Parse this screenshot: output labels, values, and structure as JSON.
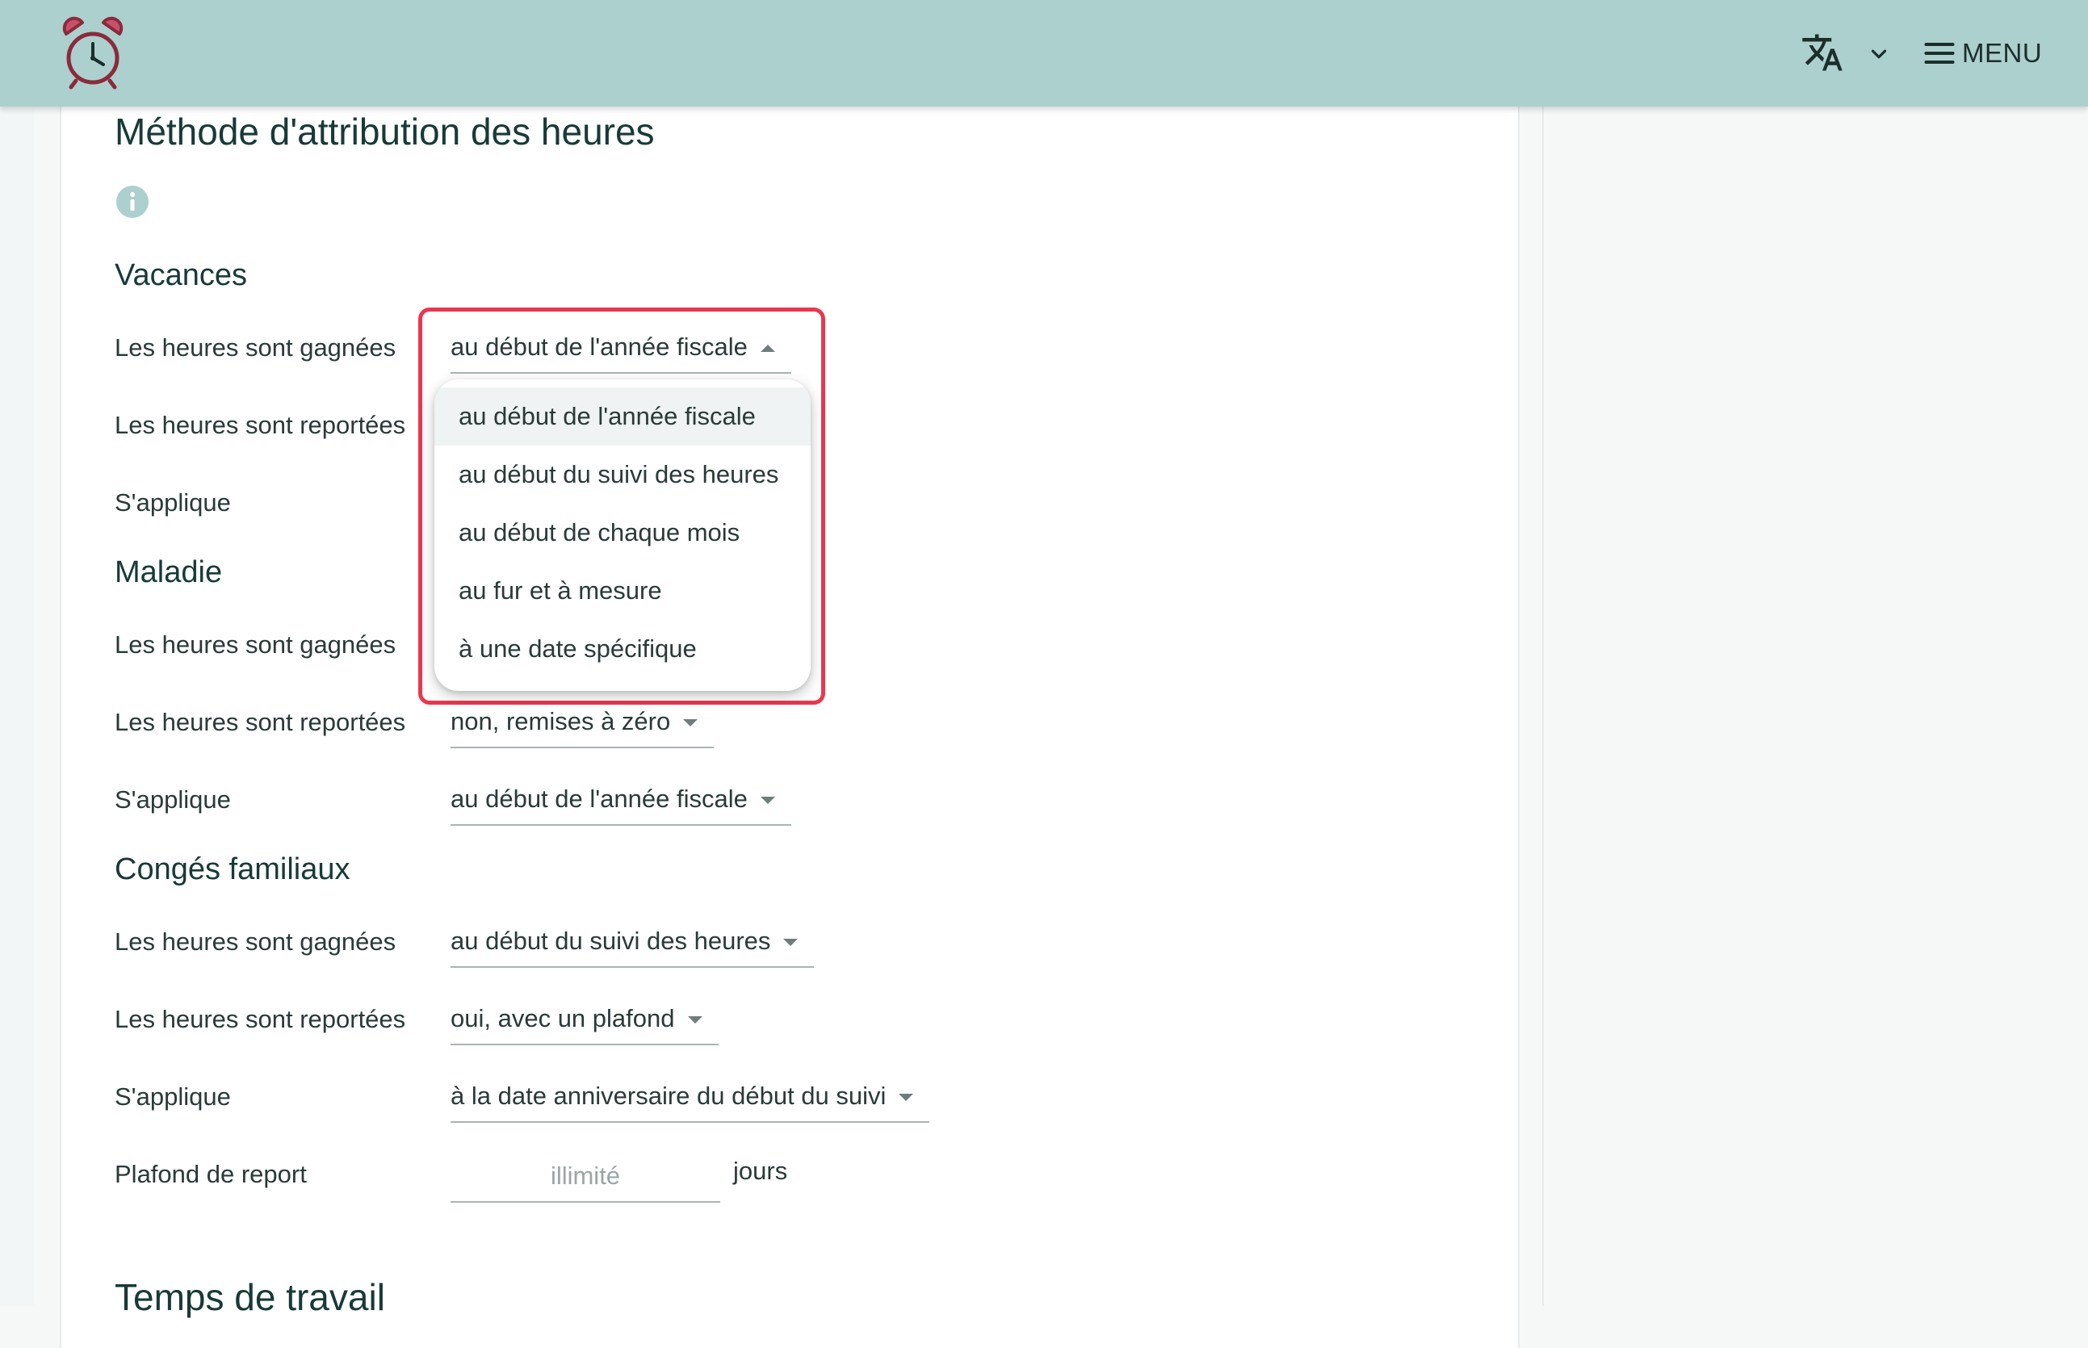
{
  "header": {
    "logo_icon": "alarm-clock-icon",
    "language_icon": "translate-icon",
    "language_chevron_icon": "chevron-down-icon",
    "menu_icon": "hamburger-icon",
    "menu_label": "MENU",
    "bg_color": "#acd0ce"
  },
  "page": {
    "title": "Méthode d'attribution des heures",
    "info_icon": "info-icon",
    "next_section_title": "Temps de travail"
  },
  "labels": {
    "earned": "Les heures sont gagnées",
    "carried": "Les heures sont reportées",
    "applies": "S'applique",
    "cap": "Plafond de report"
  },
  "sections": [
    {
      "title": "Vacances",
      "earned": "au début de l'année fiscale",
      "earned_open": true
    },
    {
      "title": "Maladie",
      "carried": "non, remises à zéro",
      "applies": "au début de l'année fiscale"
    },
    {
      "title": "Congés familiaux",
      "earned": "au début du suivi des heures",
      "carried": "oui, avec un plafond",
      "applies": "à la date anniversaire du début du suivi",
      "cap_placeholder": "illimité",
      "cap_unit": "jours"
    }
  ],
  "dropdown": {
    "options": [
      "au début de l'année fiscale",
      "au début du suivi des heures",
      "au début de chaque mois",
      "au fur et à mesure",
      "à une date spécifique"
    ],
    "highlight_color": "#e8384f"
  }
}
